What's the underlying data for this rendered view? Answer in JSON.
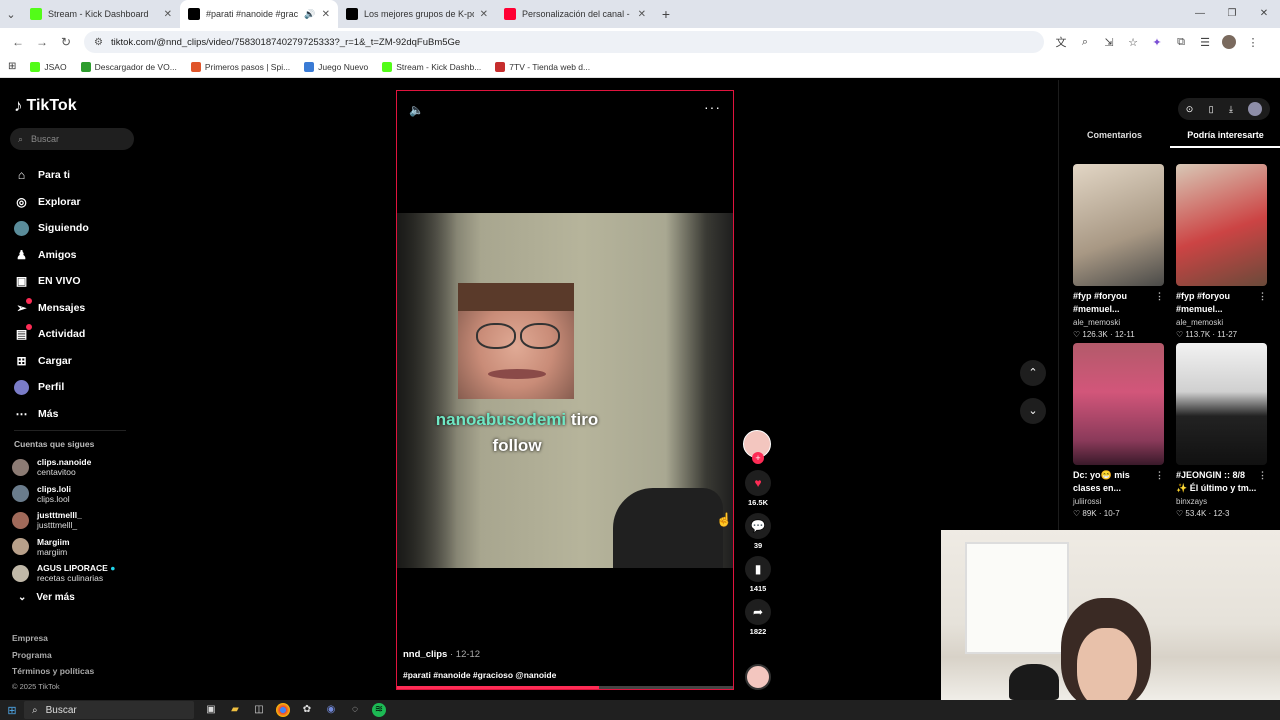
{
  "browser": {
    "tabs": [
      {
        "title": "Stream - Kick Dashboard",
        "favicon_color": "#53fc18"
      },
      {
        "title": "#parati #nanoide #gracios",
        "favicon_color": "#000000"
      },
      {
        "title": "Los mejores grupos de K-pop",
        "favicon_color": "#000000"
      },
      {
        "title": "Personalización del canal - You",
        "favicon_color": "#ff0033"
      }
    ],
    "url": "tiktok.com/@nnd_clips/video/7583018740279725333?_r=1&_t=ZM-92dqFuBm5Ge",
    "bookmarks": [
      {
        "label": "JSAO",
        "color": "#53fc18"
      },
      {
        "label": "Descargador de VO...",
        "color": "#2d9c2d"
      },
      {
        "label": "Primeros pasos | Spi...",
        "color": "#e0552a"
      },
      {
        "label": "Juego Nuevo",
        "color": "#3a7bd5"
      },
      {
        "label": "Stream - Kick Dashb...",
        "color": "#53fc18"
      },
      {
        "label": "7TV - Tienda web d...",
        "color": "#c62d2d"
      }
    ]
  },
  "tiktok": {
    "logo": "TikTok",
    "search_placeholder": "Buscar",
    "menu": [
      {
        "label": "Para ti",
        "icon": "home-icon",
        "glyph": "⌂"
      },
      {
        "label": "Explorar",
        "icon": "compass-icon",
        "glyph": "◎"
      },
      {
        "label": "Siguiendo",
        "icon": "following-avatar",
        "glyph": ""
      },
      {
        "label": "Amigos",
        "icon": "friends-icon",
        "glyph": "♟"
      },
      {
        "label": "EN VIVO",
        "icon": "live-icon",
        "glyph": "▣"
      },
      {
        "label": "Mensajes",
        "icon": "messages-icon",
        "glyph": "➢"
      },
      {
        "label": "Actividad",
        "icon": "activity-icon",
        "glyph": "▤"
      },
      {
        "label": "Cargar",
        "icon": "upload-icon",
        "glyph": "⊞"
      },
      {
        "label": "Perfil",
        "icon": "profile-avatar",
        "glyph": ""
      },
      {
        "label": "Más",
        "icon": "more-icon",
        "glyph": "⋯"
      }
    ],
    "following_title": "Cuentas que sigues",
    "following": [
      {
        "name": "clips.nanoide",
        "sub": "centavitoo"
      },
      {
        "name": "clips.loli",
        "sub": "clips.lool"
      },
      {
        "name": "justttmelll_",
        "sub": "justttmelll_"
      },
      {
        "name": "Margiim",
        "sub": "margiim"
      },
      {
        "name": "AGUS LIPORACE",
        "sub": "recetas culinarias",
        "verified": true
      }
    ],
    "see_more": "Ver más",
    "footer": [
      "Empresa",
      "Programa",
      "Términos y políticas"
    ],
    "copyright": "© 2025 TikTok"
  },
  "video": {
    "caption_highlight": "nanoabusodemi",
    "caption_rest": " tiro",
    "caption_line2": "follow",
    "username": "nnd_clips",
    "date": "12-12",
    "hashtags": "#parati #nanoide #gracioso @nanoide",
    "progress": 0.6,
    "likes": "16.5K",
    "comments": "39",
    "saves": "1415",
    "shares": "1822"
  },
  "right_panel": {
    "tabs": [
      "Comentarios",
      "Podría interesarte"
    ],
    "active_tab": 1,
    "cards": [
      {
        "title": "#fyp #foryou #memuel...",
        "author": "ale_memoski",
        "stats": "♡ 126.3K · 12-11",
        "thumb": "t1"
      },
      {
        "title": "#fyp #foryou #memuel...",
        "author": "ale_memoski",
        "stats": "♡ 113.7K · 11-27",
        "thumb": "t2"
      },
      {
        "title": "Dc: yo😁 mis clases en...",
        "author": "juliirossi",
        "stats": "♡ 89K · 10-7",
        "thumb": "t3"
      },
      {
        "title": "#JEONGIN :: 8/8 ✨ Él último y tm...",
        "author": "binxzays",
        "stats": "♡ 53.4K · 12-3",
        "thumb": "t4"
      }
    ]
  },
  "taskbar": {
    "search_label": "Buscar"
  }
}
